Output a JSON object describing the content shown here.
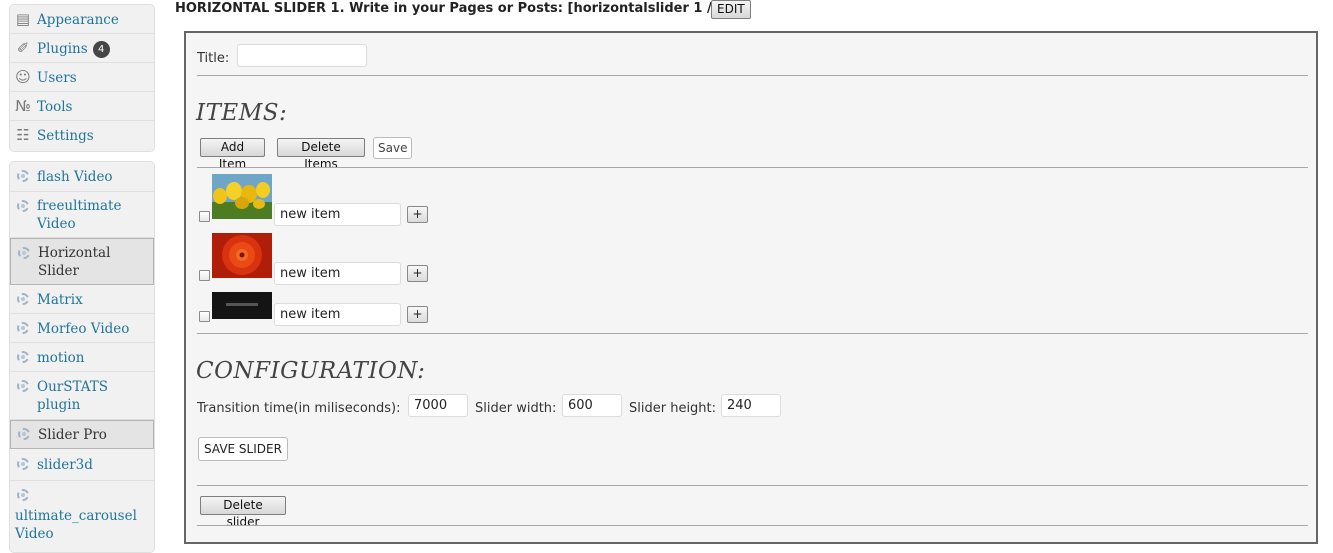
{
  "sidebar": {
    "admin_items": [
      {
        "label": "Appearance",
        "icon": "appearance-icon"
      },
      {
        "label": "Plugins",
        "icon": "plugins-icon",
        "badge": "4"
      },
      {
        "label": "Users",
        "icon": "users-icon"
      },
      {
        "label": "Tools",
        "icon": "tools-icon"
      },
      {
        "label": "Settings",
        "icon": "settings-icon"
      }
    ],
    "plugin_items": [
      {
        "label": "flash Video",
        "icon": "cog-icon"
      },
      {
        "label": "freeultimate Video",
        "icon": "cog-icon"
      },
      {
        "label": "Horizontal Slider",
        "icon": "cog-icon",
        "current": true
      },
      {
        "label": "Matrix",
        "icon": "cog-icon"
      },
      {
        "label": "Morfeo Video",
        "icon": "cog-icon"
      },
      {
        "label": "motion",
        "icon": "cog-icon"
      },
      {
        "label": "OurSTATS plugin",
        "icon": "cog-icon"
      },
      {
        "label": "Slider Pro",
        "icon": "cog-icon",
        "current": true
      },
      {
        "label": "slider3d",
        "icon": "cog-icon"
      },
      {
        "label": "ultimate_carousel Video",
        "icon": "cog-icon"
      }
    ]
  },
  "header": {
    "title": "HORIZONTAL SLIDER 1. Write in your Pages or Posts: [horizontalslider 1 /]",
    "edit_label": "EDIT"
  },
  "form": {
    "title_label": "Title:",
    "title_value": "",
    "items_heading": "ITEMS:",
    "add_item_label": "Add Item",
    "delete_items_label": "Delete Items",
    "save_label": "Save",
    "items": [
      {
        "name": "new item",
        "image": "yellow-tulips-thumbnail",
        "checked": false
      },
      {
        "name": "new item",
        "image": "orange-flower-thumbnail",
        "checked": false
      },
      {
        "name": "new item",
        "image": "slider-pro-logo-thumbnail",
        "checked": false
      }
    ],
    "item_plus_label": "+",
    "config_heading": "CONFIGURATION:",
    "transition_label": "Transition time(in miliseconds):",
    "transition_value": "7000",
    "width_label": "Slider width:",
    "width_value": "600",
    "height_label": "Slider height:",
    "height_value": "240",
    "save_slider_label": "SAVE SLIDER",
    "delete_slider_label": "Delete slider"
  },
  "colors": {
    "link": "#21759b",
    "badge": "#464646",
    "panel_border": "#666666"
  }
}
